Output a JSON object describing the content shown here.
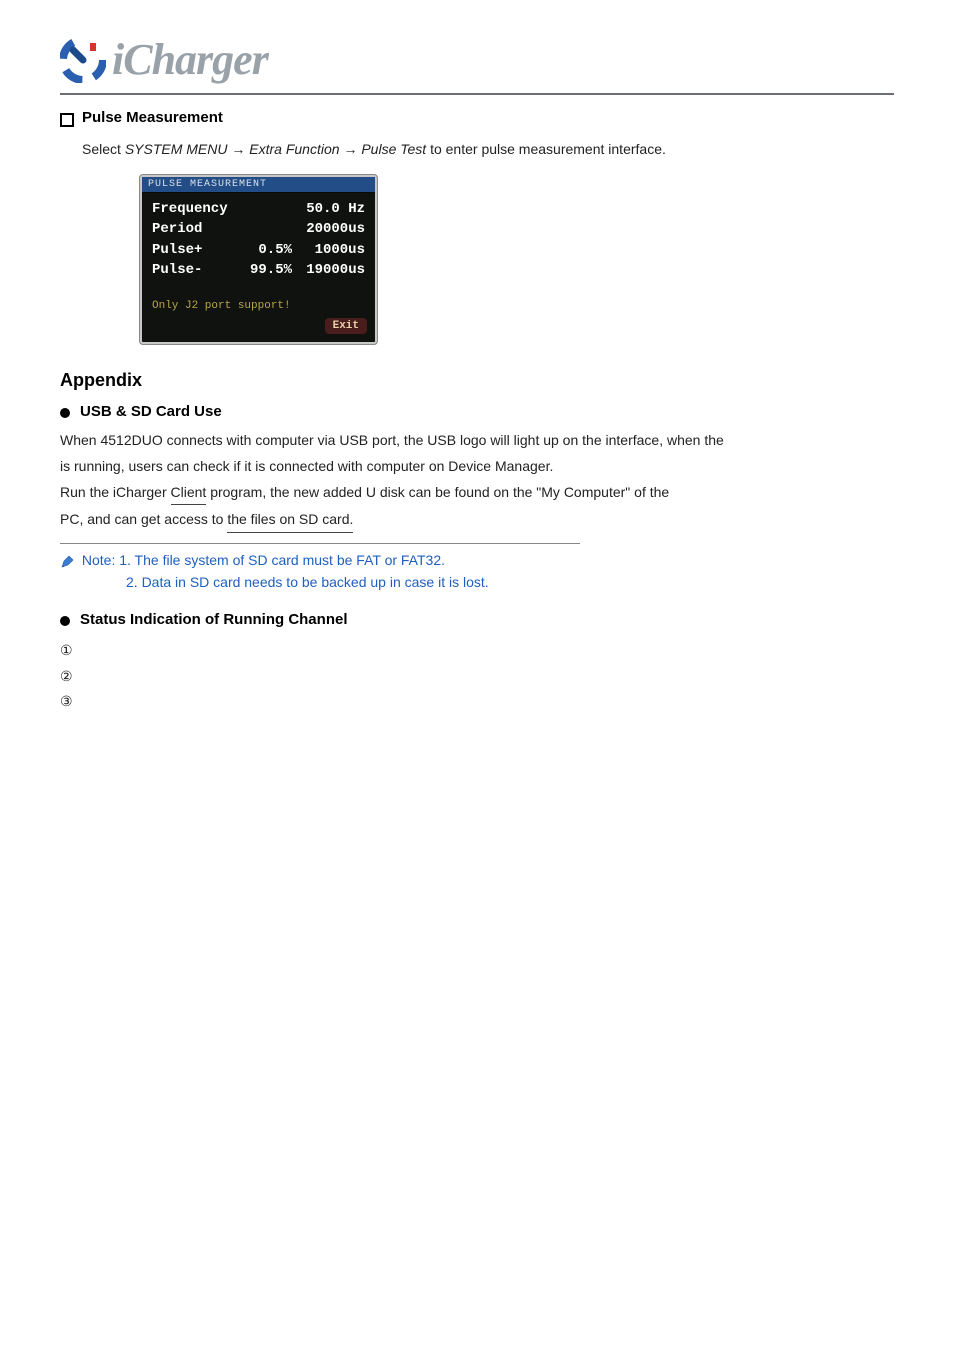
{
  "logo": {
    "text": "iCharger"
  },
  "section": {
    "bullet_title": "Pulse Measurement",
    "path_prefix": "Select ",
    "path_seg1": "SYSTEM MENU",
    "path_seg2": "Extra Function",
    "path_seg3": "Pulse Test",
    "path_suffix": " to enter pulse measurement interface."
  },
  "screen": {
    "title": "PULSE MEASUREMENT",
    "rows": [
      {
        "label": "Frequency",
        "pct": "",
        "val": "50.0 Hz"
      },
      {
        "label": "Period",
        "pct": "",
        "val": "20000us"
      },
      {
        "label": "Pulse+",
        "pct": "0.5%",
        "val": "1000us"
      },
      {
        "label": "Pulse-",
        "pct": "99.5%",
        "val": "19000us"
      }
    ],
    "note": "Only J2 port support!",
    "exit": "Exit"
  },
  "appendix": {
    "heading": "Appendix",
    "status_head": "Status Indication of Running Channel",
    "sd_title": "USB & SD Card Use",
    "sd_p1a": "When 4512DUO connects with computer via USB port, the USB logo will light up on the interface, when the",
    "sd_p1b": "is running, users can check if it is connected with computer on Device Manager.",
    "sd_p2a": "Run the iCharger ",
    "sd_p2b_ul": "Client",
    "sd_p2c": " program, the new added U disk can be found on the \"My Computer\" of the",
    "sd_p3a": "PC, and can get access to ",
    "sd_p3b_ul": "the files on SD card.",
    "note_lead": "Note: 1. The file system of SD card must be FAT or FAT32.",
    "note_l2": "2. Data in SD card needs to be backed up in case it is lost.",
    "circled": {
      "c1": "①",
      "c2": "②",
      "c3": "③"
    }
  }
}
